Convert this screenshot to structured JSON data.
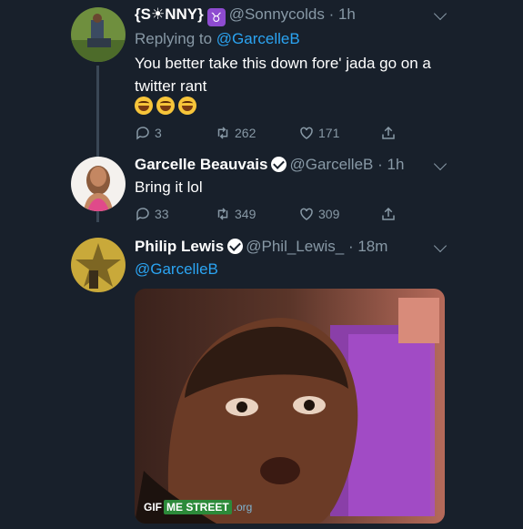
{
  "tweets": [
    {
      "name": "{S☀NNY}",
      "handle": "@Sonnycolds",
      "time": "· 1h",
      "replying_prefix": "Replying to",
      "replying_to": "@GarcelleB",
      "text": "You better take this down fore' jada go on a twitter rant",
      "replies": "3",
      "retweets": "262",
      "likes": "171",
      "emoji_icons": [
        "grinning-sweat-icon",
        "grin-icon",
        "tears-of-joy-icon"
      ],
      "badge_icon": "taurus-icon"
    },
    {
      "name": "Garcelle Beauvais",
      "handle": "@GarcelleB",
      "time": "· 1h",
      "text": "Bring it lol",
      "replies": "33",
      "retweets": "349",
      "likes": "309",
      "badge_icon": "verified-icon"
    },
    {
      "name": "Philip Lewis",
      "handle": "@Phil_Lewis_",
      "time": "· 18m",
      "text": "@GarcelleB",
      "badge_icon": "verified-icon",
      "gif": {
        "badge_gif": "GIF",
        "badge_street": "ME STREET",
        "badge_org": ".org"
      }
    }
  ],
  "colors": {
    "background": "#18202b",
    "muted": "#8899a6",
    "link": "#2ba4f2"
  }
}
